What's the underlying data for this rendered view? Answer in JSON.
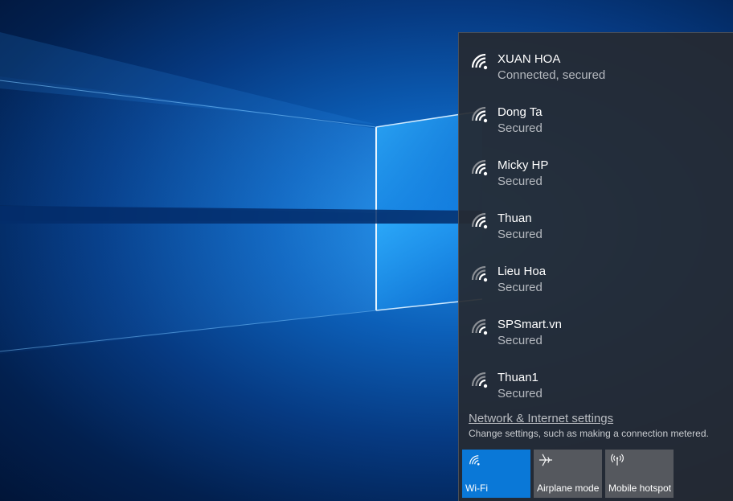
{
  "networks": [
    {
      "name": "XUAN HOA",
      "status": "Connected, secured"
    },
    {
      "name": "Dong Ta",
      "status": "Secured"
    },
    {
      "name": "Micky HP",
      "status": "Secured"
    },
    {
      "name": "Thuan",
      "status": "Secured"
    },
    {
      "name": "Lieu Hoa",
      "status": "Secured"
    },
    {
      "name": "SPSmart.vn",
      "status": "Secured"
    },
    {
      "name": "Thuan1",
      "status": "Secured"
    }
  ],
  "settings": {
    "link_label": "Network & Internet settings",
    "description": "Change settings, such as making a connection metered."
  },
  "quick_actions": [
    {
      "label": "Wi-Fi",
      "icon": "wifi-icon",
      "active": true
    },
    {
      "label": "Airplane mode",
      "icon": "airplane-icon",
      "active": false
    },
    {
      "label": "Mobile hotspot",
      "icon": "hotspot-icon",
      "active": false
    }
  ],
  "colors": {
    "accent": "#0a78d7",
    "flyout_bg": "#262a32",
    "tile_bg": "#585b61"
  }
}
